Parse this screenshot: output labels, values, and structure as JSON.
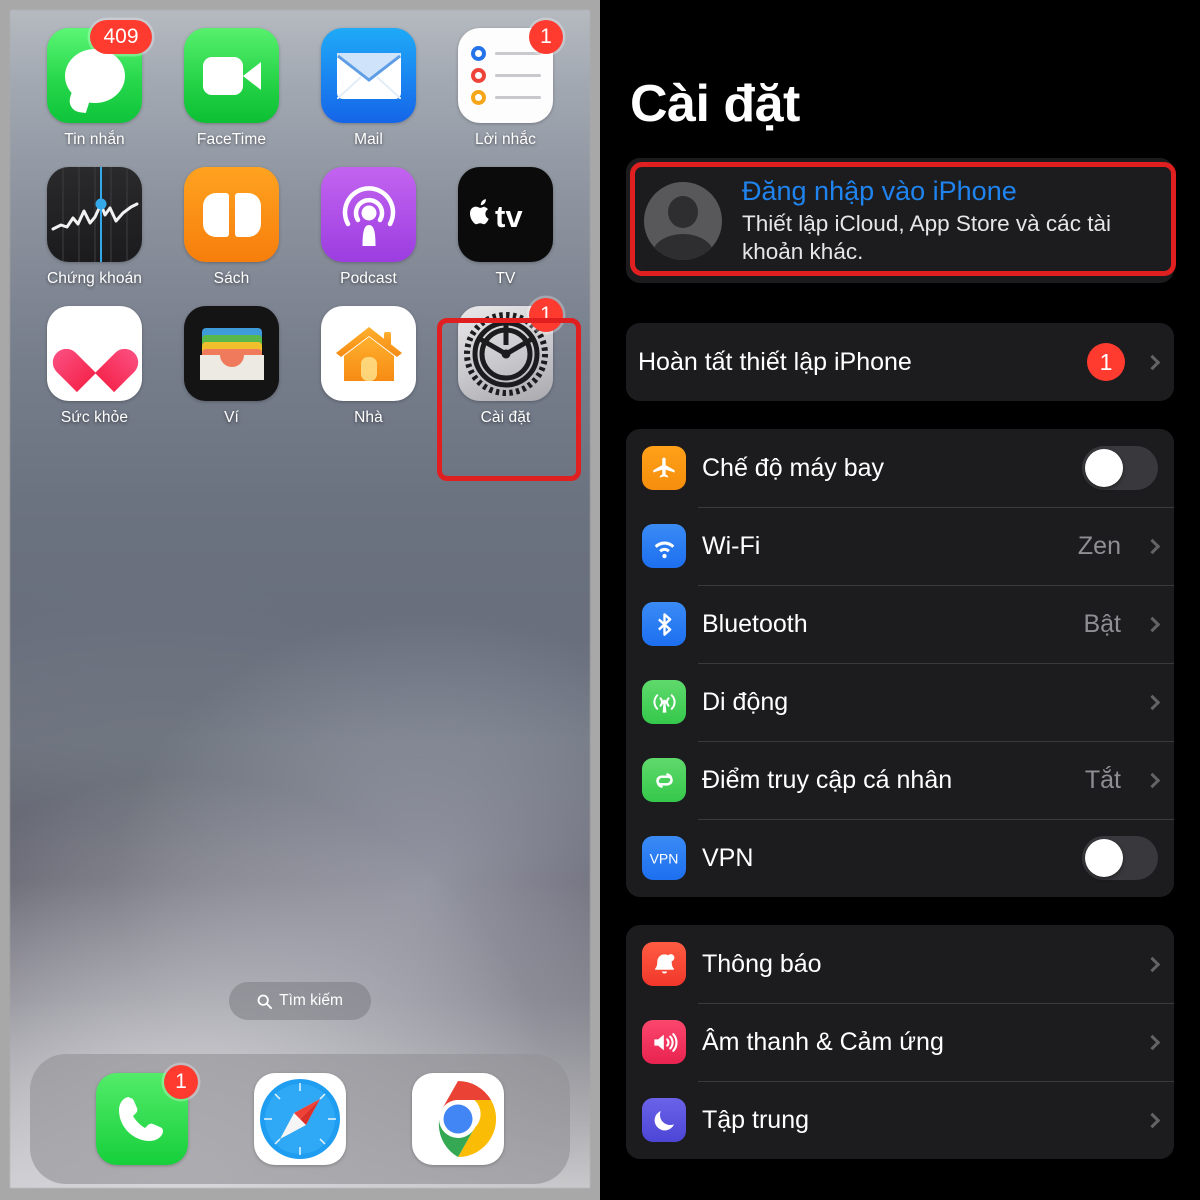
{
  "home": {
    "search": {
      "label": "Tìm kiếm",
      "icon": "search-icon"
    },
    "apps": [
      {
        "name": "Tin nhắn",
        "icon": "messages-icon",
        "badge": "409"
      },
      {
        "name": "FaceTime",
        "icon": "facetime-icon",
        "badge": ""
      },
      {
        "name": "Mail",
        "icon": "mail-icon",
        "badge": ""
      },
      {
        "name": "Lời nhắc",
        "icon": "reminders-icon",
        "badge": "1"
      },
      {
        "name": "Chứng khoán",
        "icon": "stocks-icon",
        "badge": ""
      },
      {
        "name": "Sách",
        "icon": "books-icon",
        "badge": ""
      },
      {
        "name": "Podcast",
        "icon": "podcasts-icon",
        "badge": ""
      },
      {
        "name": "TV",
        "icon": "appletv-icon",
        "badge": ""
      },
      {
        "name": "Sức khỏe",
        "icon": "health-icon",
        "badge": ""
      },
      {
        "name": "Ví",
        "icon": "wallet-icon",
        "badge": ""
      },
      {
        "name": "Nhà",
        "icon": "home-icon",
        "badge": ""
      },
      {
        "name": "Cài đặt",
        "icon": "settings-gear-icon",
        "badge": "1"
      }
    ],
    "dock": [
      {
        "name": "Điện thoại",
        "icon": "phone-icon",
        "badge": "1"
      },
      {
        "name": "Safari",
        "icon": "safari-icon",
        "badge": ""
      },
      {
        "name": "Chrome",
        "icon": "chrome-icon",
        "badge": ""
      }
    ]
  },
  "settings": {
    "title": "Cài đặt",
    "account": {
      "title": "Đăng nhập vào iPhone",
      "subtitle": "Thiết lập iCloud, App Store và các tài khoản khác.",
      "avatar_icon": "person-avatar-icon"
    },
    "setup": {
      "label": "Hoàn tất thiết lập iPhone",
      "badge": "1",
      "chevron": "chevron-right-icon"
    },
    "connectivity": [
      {
        "label": "Chế độ máy bay",
        "icon": "airplane-icon",
        "control": "toggle",
        "value": "",
        "on": false
      },
      {
        "label": "Wi-Fi",
        "icon": "wifi-icon",
        "control": "value",
        "value": "Zen"
      },
      {
        "label": "Bluetooth",
        "icon": "bluetooth-icon",
        "control": "value",
        "value": "Bật"
      },
      {
        "label": "Di động",
        "icon": "cellular-icon",
        "control": "chevron",
        "value": ""
      },
      {
        "label": "Điểm truy cập cá nhân",
        "icon": "hotspot-icon",
        "control": "value",
        "value": "Tắt"
      },
      {
        "label": "VPN",
        "icon": "vpn-icon",
        "control": "toggle",
        "value": "",
        "on": false
      }
    ],
    "notifications": [
      {
        "label": "Thông báo",
        "icon": "bell-icon",
        "control": "chevron",
        "value": ""
      },
      {
        "label": "Âm thanh & Cảm ứng",
        "icon": "speaker-icon",
        "control": "chevron",
        "value": ""
      },
      {
        "label": "Tập trung",
        "icon": "moon-icon",
        "control": "chevron",
        "value": ""
      }
    ]
  },
  "annotations": {
    "accent_color": "#e02020",
    "highlight_settings_app": "Cài đặt",
    "highlight_account_row": "Đăng nhập vào iPhone"
  }
}
